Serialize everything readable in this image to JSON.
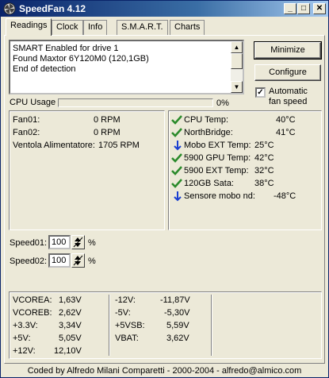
{
  "window": {
    "title": "SpeedFan 4.12",
    "controls": {
      "minimize": "_",
      "restore": "□",
      "close": "✕"
    }
  },
  "tabs": [
    "Readings",
    "Clock",
    "Info",
    "S.M.A.R.T.",
    "Charts"
  ],
  "active_tab": "Readings",
  "log": [
    "SMART Enabled for drive 1",
    "Found Maxtor 6Y120M0 (120,1GB)",
    "End of detection"
  ],
  "buttons": {
    "minimize": "Minimize",
    "configure": "Configure"
  },
  "auto_fan": {
    "label_line1": "Automatic",
    "label_line2": "fan speed",
    "checked": true
  },
  "cpu_usage": {
    "label": "CPU Usage",
    "percent_text": "0%",
    "value": 0
  },
  "fans": [
    {
      "name": "Fan01:",
      "value": "0 RPM"
    },
    {
      "name": "Fan02:",
      "value": "0 RPM"
    },
    {
      "name": "Ventola Alimentatore:",
      "value": "1705 RPM"
    }
  ],
  "temps": [
    {
      "name": "CPU Temp:",
      "value": "40°C",
      "icon": "check-icon",
      "color": "#2a8a2a"
    },
    {
      "name": "NorthBridge:",
      "value": "41°C",
      "icon": "check-icon",
      "color": "#2a8a2a"
    },
    {
      "name": "Mobo EXT Temp:",
      "value": "25°C",
      "icon": "arrow-down-icon",
      "color": "#1a3fd0"
    },
    {
      "name": "5900 GPU Temp:",
      "value": "42°C",
      "icon": "check-icon",
      "color": "#2a8a2a"
    },
    {
      "name": "5900 EXT Temp:",
      "value": "32°C",
      "icon": "check-icon",
      "color": "#2a8a2a"
    },
    {
      "name": "120GB Sata:",
      "value": "38°C",
      "icon": "check-icon",
      "color": "#2a8a2a"
    },
    {
      "name": "Sensore mobo nd:",
      "value": "-48°C",
      "icon": "arrow-down-icon",
      "color": "#1a3fd0"
    }
  ],
  "speeds": [
    {
      "label": "Speed01:",
      "value": "100",
      "unit": "%"
    },
    {
      "label": "Speed02:",
      "value": "100",
      "unit": "%"
    }
  ],
  "voltages_col1": [
    {
      "name": "VCOREA:",
      "value": "1,63V"
    },
    {
      "name": "VCOREB:",
      "value": "2,62V"
    },
    {
      "name": "+3.3V:",
      "value": "3,34V"
    },
    {
      "name": "+5V:",
      "value": "5,05V"
    },
    {
      "name": "+12V:",
      "value": "12,10V"
    }
  ],
  "voltages_col2": [
    {
      "name": "-12V:",
      "value": "-11,87V"
    },
    {
      "name": "-5V:",
      "value": "-5,30V"
    },
    {
      "name": "+5VSB:",
      "value": "5,59V"
    },
    {
      "name": "VBAT:",
      "value": "3,62V"
    }
  ],
  "footer": "Coded by Alfredo Milani Comparetti - 2000-2004 - alfredo@almico.com"
}
